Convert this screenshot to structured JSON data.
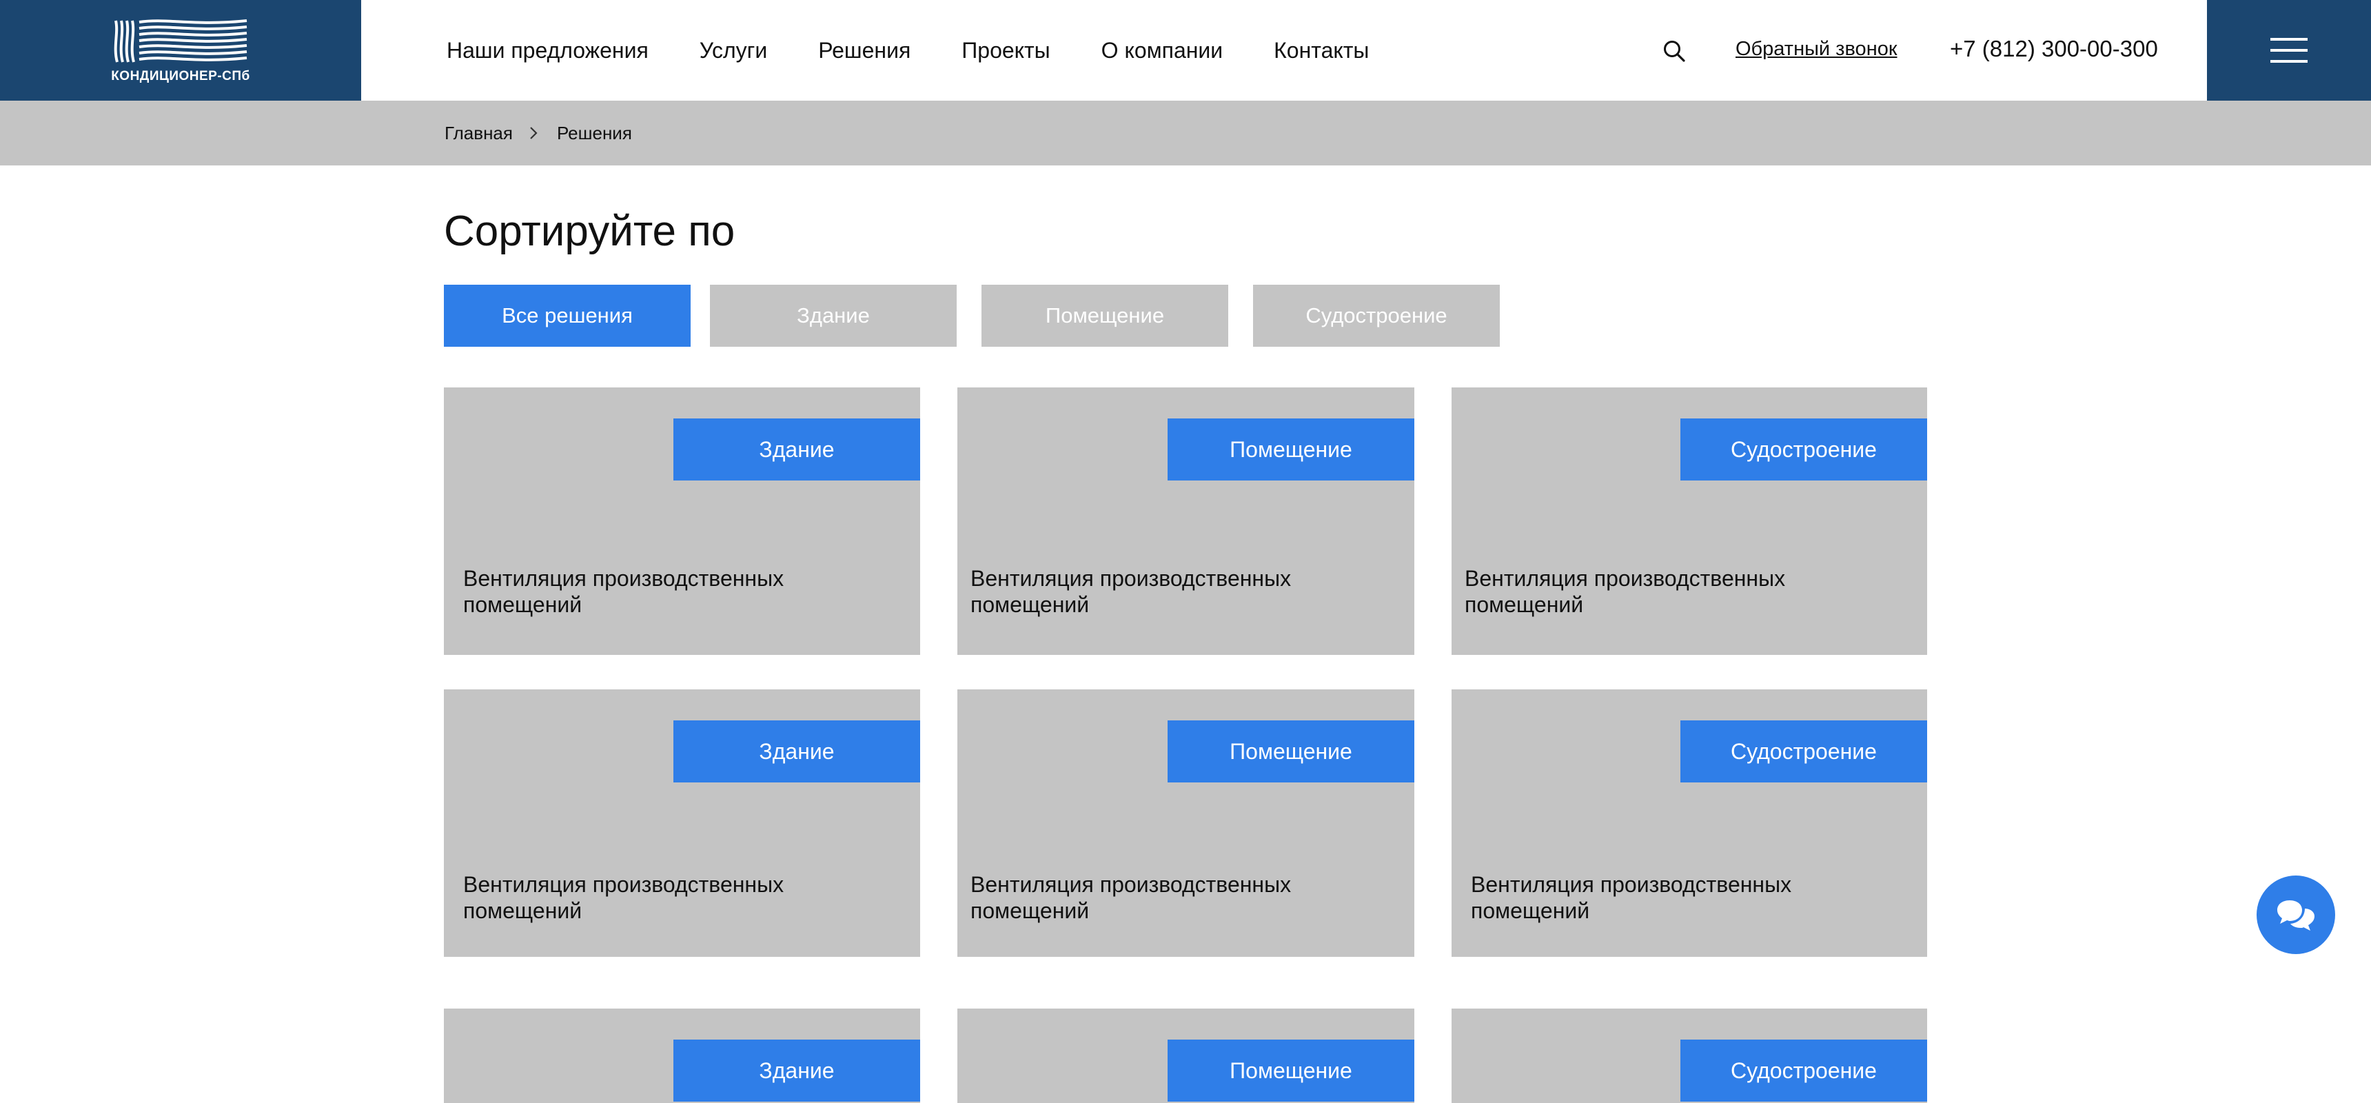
{
  "logo": {
    "text": "КОНДИЦИОНЕР-СПб",
    "icon": "logo-waves-icon"
  },
  "nav": {
    "items": [
      {
        "label": "Наши предложения"
      },
      {
        "label": "Услуги"
      },
      {
        "label": "Решения"
      },
      {
        "label": "Проекты"
      },
      {
        "label": "О компании"
      },
      {
        "label": "Контакты"
      }
    ]
  },
  "header": {
    "search_icon": "search-icon",
    "callback_label": "Обратный звонок",
    "phone": "+7 (812) 300-00-300",
    "menu_icon": "hamburger-icon"
  },
  "breadcrumb": {
    "home": "Главная",
    "current": "Решения"
  },
  "sort": {
    "title": "Сортируйте по",
    "filters": [
      {
        "label": "Все решения",
        "active": true
      },
      {
        "label": "Здание",
        "active": false
      },
      {
        "label": "Помещение",
        "active": false
      },
      {
        "label": "Судостроение",
        "active": false
      }
    ]
  },
  "cards": [
    {
      "tag": "Здание",
      "title_line1": "Вентиляция производственных",
      "title_line2": "помещений"
    },
    {
      "tag": "Помещение",
      "title_line1": "Вентиляция производственных",
      "title_line2": "помещений"
    },
    {
      "tag": "Судостроение",
      "title_line1": "Вентиляция производственных",
      "title_line2": "помещений"
    },
    {
      "tag": "Здание",
      "title_line1": "Вентиляция производственных",
      "title_line2": "помещений"
    },
    {
      "tag": "Помещение",
      "title_line1": "Вентиляция производственных",
      "title_line2": "помещений"
    },
    {
      "tag": "Судостроение",
      "title_line1": "Вентиляция производственных",
      "title_line2": "помещений"
    },
    {
      "tag": "Здание",
      "title_line1": "",
      "title_line2": ""
    },
    {
      "tag": "Помещение",
      "title_line1": "",
      "title_line2": ""
    },
    {
      "tag": "Судостроение",
      "title_line1": "",
      "title_line2": ""
    }
  ],
  "chat": {
    "icon": "chat-bubbles-icon"
  },
  "colors": {
    "brand_dark": "#1b4670",
    "accent": "#2f7ee8",
    "placeholder_gray": "#c4c4c4"
  }
}
